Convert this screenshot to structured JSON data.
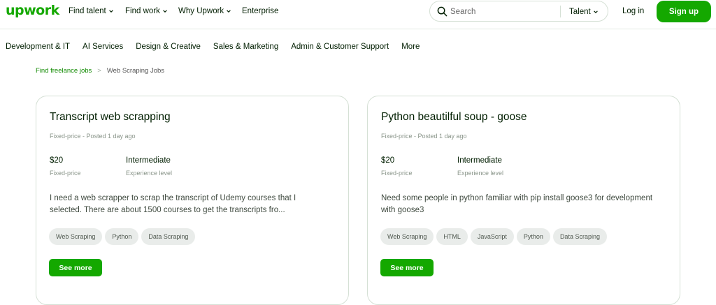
{
  "header": {
    "logo": "upwork",
    "nav": [
      "Find talent",
      "Find work",
      "Why Upwork",
      "Enterprise"
    ],
    "search": {
      "placeholder": "Search",
      "scope": "Talent"
    },
    "login": "Log in",
    "signup": "Sign up"
  },
  "categories": [
    "Development & IT",
    "AI Services",
    "Design & Creative",
    "Sales & Marketing",
    "Admin & Customer Support",
    "More"
  ],
  "breadcrumb": {
    "link": "Find freelance jobs",
    "separator": ">",
    "current": "Web Scraping Jobs"
  },
  "jobs": [
    {
      "title": "Transcript web scrapping",
      "meta": "Fixed-price - Posted 1 day ago",
      "price": "$20",
      "price_label": "Fixed-price",
      "level": "Intermediate",
      "level_label": "Experience level",
      "description": "I need a web scrapper to scrap the transcript of Udemy courses that I selected. There are about 1500 courses to get the transcripts fro...",
      "tags": [
        "Web Scraping",
        "Python",
        "Data Scraping"
      ],
      "cta": "See more"
    },
    {
      "title": "Python beautilful soup - goose",
      "meta": "Fixed-price - Posted 1 day ago",
      "price": "$20",
      "price_label": "Fixed-price",
      "level": "Intermediate",
      "level_label": "Experience level",
      "description": "Need some people in python familiar with pip install goose3 for development with goose3",
      "tags": [
        "Web Scraping",
        "HTML",
        "JavaScript",
        "Python",
        "Data Scraping"
      ],
      "cta": "See more"
    }
  ],
  "colors": {
    "brand": "#14a800",
    "link": "#108a00"
  }
}
